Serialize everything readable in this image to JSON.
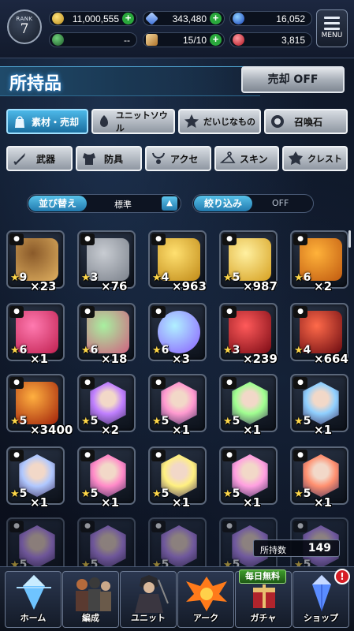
{
  "status": {
    "rank_label": "RANK",
    "rank_value": "7",
    "gil": "11,000,555",
    "crystals": "343,480",
    "blue_orbs": "16,052",
    "compass_value": "--",
    "tickets": "15/10",
    "red_orbs": "3,815",
    "menu_label": "MENU"
  },
  "header": {
    "title": "所持品",
    "sell_label": "売却 OFF"
  },
  "tabs_row1": [
    {
      "label": "素材・売却",
      "icon": "bag-icon"
    },
    {
      "label": "ユニットソウル",
      "icon": "soul-icon"
    },
    {
      "label": "だいじなもの",
      "icon": "star-icon"
    },
    {
      "label": "召喚石",
      "icon": "summon-stone-icon"
    }
  ],
  "tabs_row2": [
    {
      "label": "武器",
      "icon": "sword-icon"
    },
    {
      "label": "防具",
      "icon": "armor-icon"
    },
    {
      "label": "アクセ",
      "icon": "necklace-icon"
    },
    {
      "label": "スキン",
      "icon": "hanger-icon"
    },
    {
      "label": "クレスト",
      "icon": "crest-icon"
    }
  ],
  "sort": {
    "label": "並び替え",
    "value": "標準"
  },
  "filter": {
    "label": "絞り込み",
    "value": "OFF"
  },
  "items": [
    {
      "kind": "chest",
      "stars": "★9",
      "count": "×23"
    },
    {
      "kind": "silver",
      "stars": "★3",
      "count": "×76"
    },
    {
      "kind": "gold",
      "stars": "★4",
      "count": "×963"
    },
    {
      "kind": "goldpile",
      "stars": "★5",
      "count": "×987"
    },
    {
      "kind": "jar",
      "stars": "★6",
      "count": "×2"
    },
    {
      "kind": "jar-pink",
      "stars": "★6",
      "count": "×1"
    },
    {
      "kind": "jar-green",
      "stars": "★6",
      "count": "×18"
    },
    {
      "kind": "orb",
      "stars": "★6",
      "count": "×3"
    },
    {
      "kind": "potion",
      "stars": "★3",
      "count": "×239"
    },
    {
      "kind": "potion-big",
      "stars": "★4",
      "count": "×664"
    },
    {
      "kind": "jar-fire",
      "stars": "★5",
      "count": "×3400"
    },
    {
      "kind": "soul-purple",
      "stars": "★5",
      "count": "×2"
    },
    {
      "kind": "soul-pink",
      "stars": "★5",
      "count": "×1"
    },
    {
      "kind": "soul-green",
      "stars": "★5",
      "count": "×1"
    },
    {
      "kind": "soul-blue",
      "stars": "★5",
      "count": "×1"
    },
    {
      "kind": "soul-blue2",
      "stars": "★5",
      "count": "×1"
    },
    {
      "kind": "soul-green2",
      "stars": "★5",
      "count": "×1"
    },
    {
      "kind": "soul-yellow",
      "stars": "★5",
      "count": "×1"
    },
    {
      "kind": "soul-pink2",
      "stars": "★5",
      "count": "×1"
    },
    {
      "kind": "soul-red",
      "stars": "★5",
      "count": "×1"
    },
    {
      "kind": "soul-dim1",
      "stars": "★5",
      "count": ""
    },
    {
      "kind": "soul-dim2",
      "stars": "★5",
      "count": ""
    },
    {
      "kind": "soul-dim3",
      "stars": "★5",
      "count": ""
    },
    {
      "kind": "soul-dim4",
      "stars": "★5",
      "count": ""
    },
    {
      "kind": "soul-dim5",
      "stars": "★5",
      "count": ""
    }
  ],
  "holding": {
    "label": "所持数",
    "value": "149"
  },
  "nav": [
    {
      "label": "ホーム",
      "icon": "home-crystal-icon"
    },
    {
      "label": "編成",
      "icon": "party-icon"
    },
    {
      "label": "ユニット",
      "icon": "unit-icon"
    },
    {
      "label": "アーク",
      "icon": "ark-icon"
    },
    {
      "label": "ガチャ",
      "icon": "gacha-icon"
    },
    {
      "label": "ショップ",
      "icon": "shop-crystal-icon"
    }
  ],
  "gacha_tag": "毎日無料",
  "shop_alert": "!"
}
